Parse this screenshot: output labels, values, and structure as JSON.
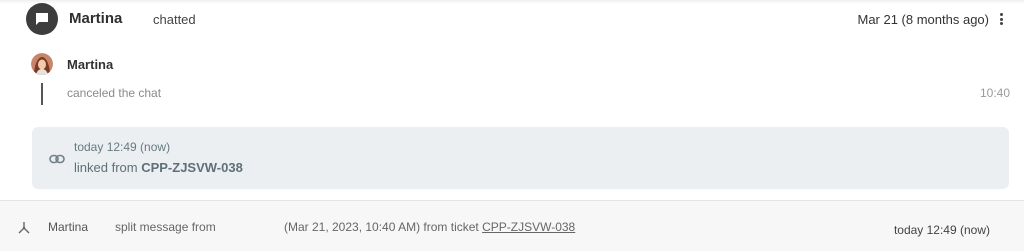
{
  "header": {
    "author": "Martina",
    "action": "chatted",
    "date": "Mar 21 (8 months ago)",
    "icons": {
      "chat": "chat-bubble-icon",
      "menu": "more-vertical-icon"
    }
  },
  "message": {
    "author": "Martina",
    "text": "canceled the chat",
    "time": "10:40",
    "avatar": "avatar"
  },
  "link_note": {
    "when": "today 12:49 (now)",
    "from_prefix": "linked from",
    "ticket": "CPP-ZJSVW-038",
    "icon": "link-icon"
  },
  "split_event": {
    "author": "Martina",
    "action": "split message from",
    "detail": "(Mar 21, 2023, 10:40 AM) from ticket",
    "ticket": "CPP-ZJSVW-038",
    "time": "today 12:49 (now)",
    "icon": "split-icon"
  },
  "colors": {
    "icon_circle": "#3d3d3d",
    "link_box_bg": "#eceff1",
    "link_text": "#5d7079",
    "bottom_row_bg": "#f7f7f7"
  }
}
